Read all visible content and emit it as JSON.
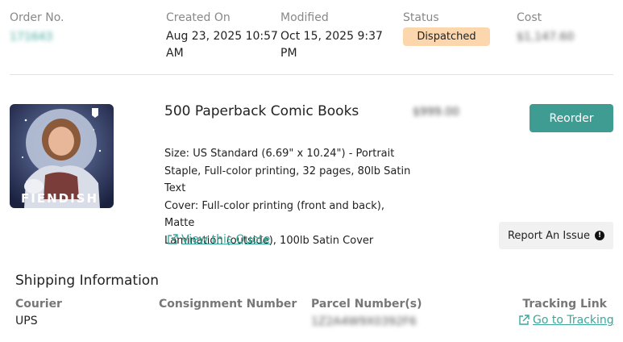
{
  "order": {
    "order_no_label": "Order No.",
    "order_no_value": "171643",
    "created_label": "Created On",
    "created_value_line1": "Aug 23, 2025 10:57",
    "created_value_line2": "AM",
    "modified_label": "Modified",
    "modified_value_line1": "Oct 15, 2025 9:37",
    "modified_value_line2": "PM",
    "status_label": "Status",
    "status_value": "Dispatched",
    "cost_label": "Cost",
    "cost_value": "$1,147.60"
  },
  "item": {
    "title": "500 Paperback Comic Books",
    "price": "$999.00",
    "thumbnail_caption": "FIENDISH",
    "spec_lines": [
      "Size: US Standard (6.69\" x 10.24\") - Portrait",
      "Staple, Full-color printing, 32 pages, 80lb Satin",
      "Text",
      "Cover: Full-color printing (front and back), Matte",
      "Lamination (outside), 100lb Satin Cover"
    ],
    "view_quote_label": "View this Quote",
    "reorder_label": "Reorder",
    "report_issue_label": "Report An Issue"
  },
  "shipping": {
    "heading": "Shipping Information",
    "courier_label": "Courier",
    "courier_value": "UPS",
    "consignment_label": "Consignment Number",
    "consignment_value": "",
    "parcel_label": "Parcel Number(s)",
    "parcel_value": "1Z2A4W9X0392F6",
    "tracking_label": "Tracking Link",
    "tracking_link_label": "Go to Tracking"
  },
  "colors": {
    "accent": "#3f9c93",
    "status_bg": "#fcd6ad"
  }
}
